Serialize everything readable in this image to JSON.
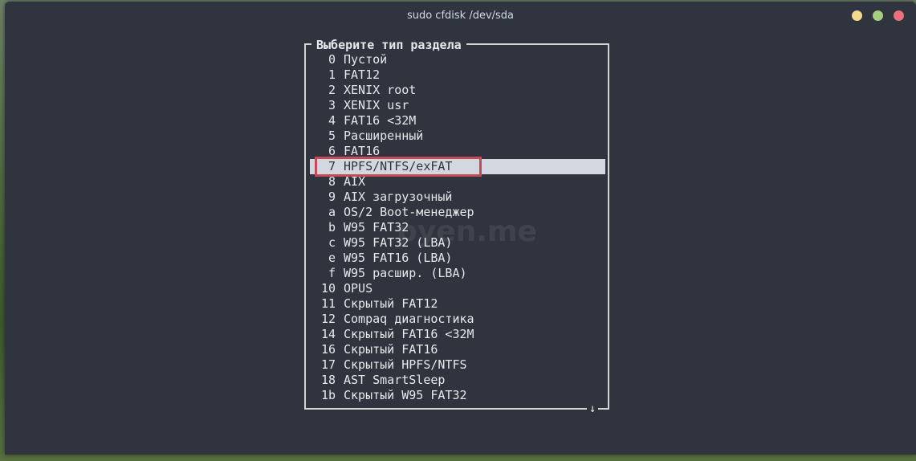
{
  "window": {
    "title": "sudo cfdisk /dev/sda",
    "buttons": [
      "minimize",
      "maximize",
      "close"
    ],
    "colors": {
      "minimize": "#f4d88b",
      "maximize": "#a5cf7c",
      "close": "#e8717b"
    }
  },
  "dialog": {
    "title": "Выберите тип раздела",
    "scroll_indicator": "↓",
    "selected_code": "7",
    "items": [
      {
        "code": "0",
        "name": "Пустой"
      },
      {
        "code": "1",
        "name": "FAT12"
      },
      {
        "code": "2",
        "name": "XENIX root"
      },
      {
        "code": "3",
        "name": "XENIX usr"
      },
      {
        "code": "4",
        "name": "FAT16 <32M"
      },
      {
        "code": "5",
        "name": "Расширенный"
      },
      {
        "code": "6",
        "name": "FAT16"
      },
      {
        "code": "7",
        "name": "HPFS/NTFS/exFAT"
      },
      {
        "code": "8",
        "name": "AIX"
      },
      {
        "code": "9",
        "name": "AIX загрузочный"
      },
      {
        "code": "a",
        "name": "OS/2 Boot-менеджер"
      },
      {
        "code": "b",
        "name": "W95 FAT32"
      },
      {
        "code": "c",
        "name": "W95 FAT32 (LBA)"
      },
      {
        "code": "e",
        "name": "W95 FAT16 (LBA)"
      },
      {
        "code": "f",
        "name": "W95 расшир. (LBA)"
      },
      {
        "code": "10",
        "name": "OPUS"
      },
      {
        "code": "11",
        "name": "Скрытый FAT12"
      },
      {
        "code": "12",
        "name": "Compaq диагностика"
      },
      {
        "code": "14",
        "name": "Скрытый FAT16 <32M"
      },
      {
        "code": "16",
        "name": "Скрытый FAT16"
      },
      {
        "code": "17",
        "name": "Скрытый HPFS/NTFS"
      },
      {
        "code": "18",
        "name": "AST SmartSleep"
      },
      {
        "code": "1b",
        "name": "Скрытый W95 FAT32"
      }
    ]
  },
  "watermark": "pyen.me",
  "accent_color": "#c24b57"
}
